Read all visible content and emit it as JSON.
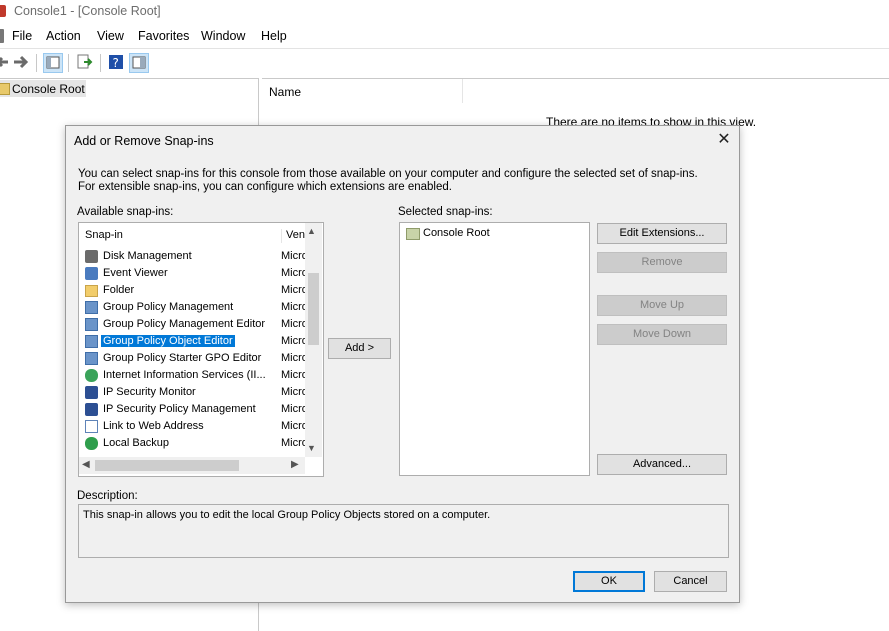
{
  "window": {
    "title": "Console1 - [Console Root]"
  },
  "menu": [
    "File",
    "Action",
    "View",
    "Favorites",
    "Window",
    "Help"
  ],
  "tree": {
    "root_label": "Console Root"
  },
  "list": {
    "column_name": "Name",
    "empty_message": "There are no items to show in this view."
  },
  "dialog": {
    "title": "Add or Remove Snap-ins",
    "intro": "You can select snap-ins for this console from those available on your computer and configure the selected set of snap-ins. For extensible snap-ins, you can configure which extensions are enabled.",
    "available_label": "Available snap-ins:",
    "selected_label": "Selected snap-ins:",
    "columns": {
      "snapin": "Snap-in",
      "vendor": "Vend"
    },
    "available": [
      {
        "name": "Disk Management",
        "vendor": "Micro",
        "icon": "disk-icon"
      },
      {
        "name": "Event Viewer",
        "vendor": "Micro",
        "icon": "event-viewer-icon"
      },
      {
        "name": "Folder",
        "vendor": "Micro",
        "icon": "folder-icon"
      },
      {
        "name": "Group Policy Management",
        "vendor": "Micro",
        "icon": "policy-icon"
      },
      {
        "name": "Group Policy Management Editor",
        "vendor": "Micro",
        "icon": "policy-icon"
      },
      {
        "name": "Group Policy Object Editor",
        "vendor": "Micro",
        "icon": "policy-icon",
        "selected": true
      },
      {
        "name": "Group Policy Starter GPO Editor",
        "vendor": "Micro",
        "icon": "policy-icon"
      },
      {
        "name": "Internet Information Services (II...",
        "vendor": "Micro",
        "icon": "iis-icon"
      },
      {
        "name": "IP Security Monitor",
        "vendor": "Micro",
        "icon": "ip-security-icon"
      },
      {
        "name": "IP Security Policy Management",
        "vendor": "Micro",
        "icon": "ip-security-icon"
      },
      {
        "name": "Link to Web Address",
        "vendor": "Micro",
        "icon": "web-link-icon"
      },
      {
        "name": "Local Backup",
        "vendor": "Micro",
        "icon": "backup-icon"
      }
    ],
    "selected_items": [
      {
        "name": "Console Root",
        "icon": "folder-icon"
      }
    ],
    "buttons": {
      "add": "Add >",
      "edit_extensions": "Edit Extensions...",
      "remove": "Remove",
      "move_up": "Move Up",
      "move_down": "Move Down",
      "advanced": "Advanced...",
      "ok": "OK",
      "cancel": "Cancel"
    },
    "description_label": "Description:",
    "description": "This snap-in allows you to edit the local Group Policy Objects stored on a computer."
  }
}
